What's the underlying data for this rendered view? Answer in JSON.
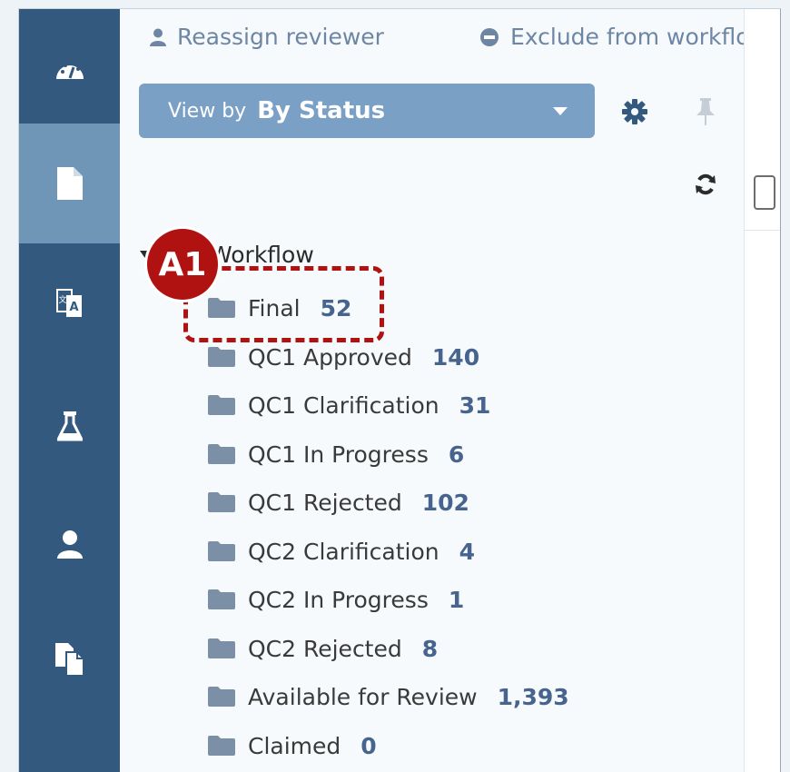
{
  "toolbar": {
    "reassign_label": "Reassign reviewer",
    "exclude_label": "Exclude from workflo"
  },
  "viewby": {
    "label": "View by",
    "value": "By Status"
  },
  "tree": {
    "title": "tep Workflow",
    "items": [
      {
        "name": "Final",
        "count": "52"
      },
      {
        "name": "QC1 Approved",
        "count": "140"
      },
      {
        "name": "QC1 Clarification",
        "count": "31"
      },
      {
        "name": "QC1 In Progress",
        "count": "6"
      },
      {
        "name": "QC1 Rejected",
        "count": "102"
      },
      {
        "name": "QC2 Clarification",
        "count": "4"
      },
      {
        "name": "QC2 In Progress",
        "count": "1"
      },
      {
        "name": "QC2 Rejected",
        "count": "8"
      },
      {
        "name": "Available for Review",
        "count": "1,393"
      },
      {
        "name": "Claimed",
        "count": "0"
      }
    ]
  },
  "annotation": {
    "badge": "A1",
    "color": "#b01111"
  },
  "rail": {
    "icons": [
      "dashboard-icon",
      "document-icon",
      "translate-icon",
      "flask-icon",
      "user-icon",
      "copy-icon"
    ],
    "active": "document-icon",
    "color": "#33597f"
  }
}
